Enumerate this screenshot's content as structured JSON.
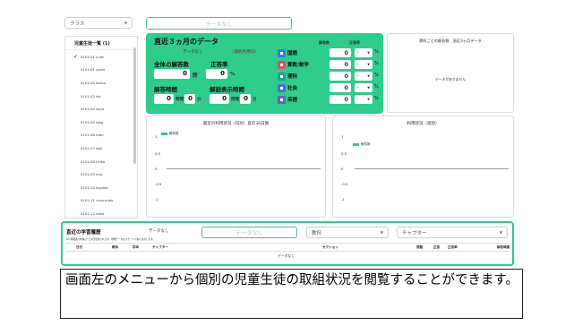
{
  "class_select": {
    "value": "クラス"
  },
  "top_no_data": "データなし",
  "sidebar": {
    "header": "児童生徒一覧 (1)",
    "items": [
      "0103-01 yuan",
      "0101-01 yoshi",
      "0101-02 kosho",
      "0101-03 kai",
      "0101-04 saya",
      "0101-05 taka",
      "0101-06 mau",
      "0101-07 taki",
      "0101-08 chika",
      "0101-09 mio",
      "0101-10 kayoko",
      "0101-11 urusuruka",
      "0101-12 reika",
      "0101-13 ruuka"
    ]
  },
  "stats": {
    "title": "直近３ヵ月のデータ",
    "no_data": "データなし",
    "usage_note": "(最終利用日)",
    "total_answers_label": "全体の解答数",
    "total_answers_value": "0",
    "total_answers_unit": "問",
    "accuracy_label": "正答率",
    "accuracy_value": "0",
    "accuracy_unit": "%",
    "answer_time_label": "解答時間",
    "display_time_label": "解説表示時間",
    "answer_hours": "0",
    "answer_minutes": "0",
    "display_hours": "0",
    "display_minutes": "0",
    "hour_unit": "時間",
    "minute_unit": "分",
    "col_answers": "解答数",
    "col_accuracy": "正答率",
    "subjects": [
      {
        "name": "国語",
        "value": "0",
        "drop": "-",
        "pct": "%",
        "color": "#3a7bd5"
      },
      {
        "name": "算数/数学",
        "value": "0",
        "drop": "-",
        "pct": "%",
        "color": "#e04b6a"
      },
      {
        "name": "理科",
        "value": "0",
        "drop": "-",
        "pct": "%",
        "color": "#2a9d8f"
      },
      {
        "name": "社会",
        "value": "0",
        "drop": "-",
        "pct": "%",
        "color": "#4a6fd6"
      },
      {
        "name": "英語",
        "value": "0",
        "drop": "-",
        "pct": "%",
        "color": "#5c6bc0"
      }
    ]
  },
  "subject_card": {
    "title": "教科ごとの解答数　直近3ヵ月データ",
    "no_data": "データがありません"
  },
  "usage_chart": {
    "title": "最近の利用状況（日別）直近30日間",
    "legend": "解答数",
    "ticks": [
      "1",
      "0.5",
      "0",
      "-0.5",
      "-1"
    ]
  },
  "history_chart": {
    "title": "利用状況（週別）",
    "legend": "解答数",
    "ticks": [
      "1",
      "0.5",
      "0",
      "-0.5",
      "-1"
    ]
  },
  "bottom": {
    "title": "直近の学習履歴",
    "no_data_label": "データなし",
    "note": "※1 明細表の内容は一日1回更新されます。明細データはスクールで右に表示します。",
    "no_data_box": "データなし",
    "subject_select": "教科",
    "chapter_select": "チャプター",
    "headers": [
      "日付",
      "教科",
      "学年",
      "チャプター",
      "セクション",
      "問題",
      "正答",
      "正答率",
      "解答時間"
    ],
    "empty": "データなし"
  },
  "caption": "画面左のメニューから個別の児童生徒の取組状況を閲覧することができます。"
}
